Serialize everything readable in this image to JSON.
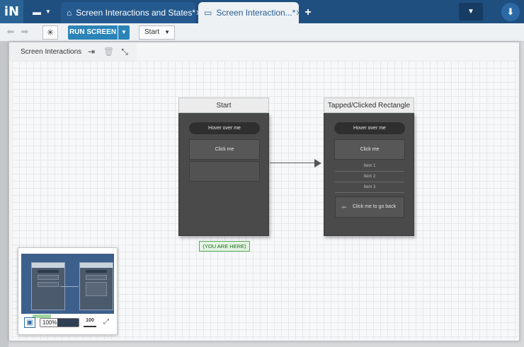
{
  "app": {
    "logo_text": "iN",
    "tabs": [
      {
        "label": "Screen Interactions and States*",
        "active": false
      },
      {
        "label": "Screen Interaction...*",
        "active": true
      }
    ],
    "new_tab_glyph": "+",
    "close_glyph": "✕",
    "accent_color": "#1f4f7f"
  },
  "toolbar": {
    "back_glyph": "⬅",
    "forward_glyph": "➡",
    "run_label": "RUN SCREEN",
    "start_select": "Start"
  },
  "panel": {
    "title": "Screen Interactions"
  },
  "screens": [
    {
      "title": "Start",
      "pill": "Hover over me",
      "rect": "Click me"
    },
    {
      "title": "Tapped/Clicked Rectangle",
      "pill": "Hover over me",
      "rect": "Click me",
      "items": [
        "Item 1",
        "Item 2",
        "Item 3"
      ],
      "back_button": "Click me to go back"
    }
  ],
  "you_are_here": "(YOU ARE HERE)",
  "minimap": {
    "zoom_text": "100%",
    "zoom_fraction": 0.45,
    "actual_size_label": "100"
  }
}
